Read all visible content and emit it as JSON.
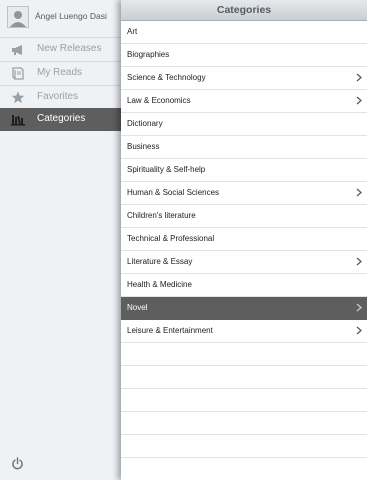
{
  "sidebar": {
    "user_name": "Ángel Luengo Dasi",
    "items": [
      {
        "label": "New Releases",
        "icon": "megaphone-icon"
      },
      {
        "label": "My Reads",
        "icon": "book-icon"
      },
      {
        "label": "Favorites",
        "icon": "star-icon"
      },
      {
        "label": "Categories",
        "icon": "bookshelf-icon",
        "active": true
      }
    ],
    "power_icon": "power-icon"
  },
  "header": {
    "title": "Categories"
  },
  "categories": [
    {
      "label": "Art",
      "has_children": false
    },
    {
      "label": "Biographies",
      "has_children": false
    },
    {
      "label": "Science & Technology",
      "has_children": true
    },
    {
      "label": "Law & Economics",
      "has_children": true
    },
    {
      "label": "Dictionary",
      "has_children": false
    },
    {
      "label": "Business",
      "has_children": false
    },
    {
      "label": "Spirituality & Self-help",
      "has_children": false
    },
    {
      "label": "Human & Social Sciences",
      "has_children": true
    },
    {
      "label": "Children's literature",
      "has_children": false
    },
    {
      "label": "Technical & Professional",
      "has_children": false
    },
    {
      "label": "Literature & Essay",
      "has_children": true
    },
    {
      "label": "Health & Medicine",
      "has_children": false
    },
    {
      "label": "Novel",
      "has_children": true,
      "selected": true
    },
    {
      "label": "Leisure & Entertainment",
      "has_children": true
    }
  ],
  "colors": {
    "selected_bg": "#5e5e5e",
    "sidebar_bg": "#eef2f4",
    "panel_bg": "#ffffff"
  }
}
